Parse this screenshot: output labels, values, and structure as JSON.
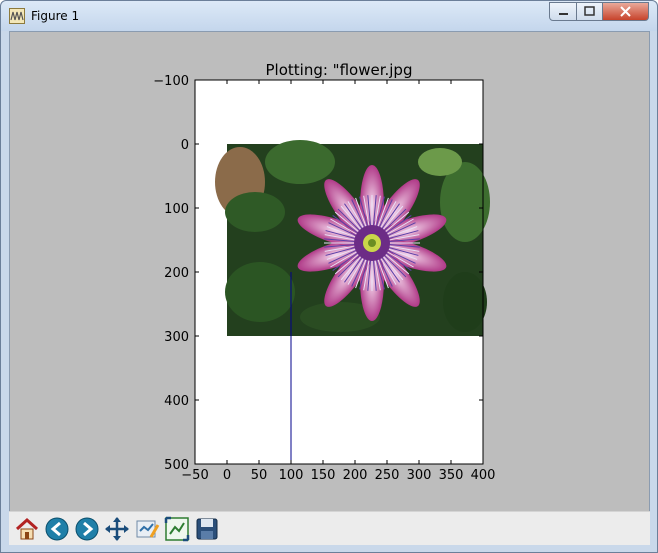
{
  "window": {
    "title": "Figure 1",
    "controls": [
      "minimize",
      "maximize",
      "close"
    ]
  },
  "figure": {
    "title": "Plotting: \"flower.jpg",
    "image_label": "flower.jpg",
    "x_ticks": [
      "−50",
      "0",
      "50",
      "100",
      "150",
      "200",
      "250",
      "300",
      "350",
      "400"
    ],
    "y_ticks": [
      "−100",
      "0",
      "100",
      "200",
      "300",
      "400",
      "500"
    ]
  },
  "chart_data": {
    "type": "line",
    "title": "Plotting: \"flower.jpg",
    "xlim": [
      -50,
      400
    ],
    "ylim": [
      500,
      -100
    ],
    "y_inverted": true,
    "image_extent": {
      "x": [
        0,
        400
      ],
      "y": [
        0,
        300
      ]
    },
    "series": [
      {
        "color": "#00008b",
        "x": [
          100,
          100
        ],
        "y": [
          200,
          500
        ]
      }
    ],
    "xlabel": "",
    "ylabel": ""
  },
  "toolbar": {
    "buttons": [
      "home-icon",
      "back-icon",
      "forward-icon",
      "pan-icon",
      "configure-subplots-icon",
      "zoom-icon",
      "save-icon"
    ]
  },
  "colors": {
    "background": "#bdbdbd",
    "axes": "#ffffff",
    "line": "#00008b"
  }
}
